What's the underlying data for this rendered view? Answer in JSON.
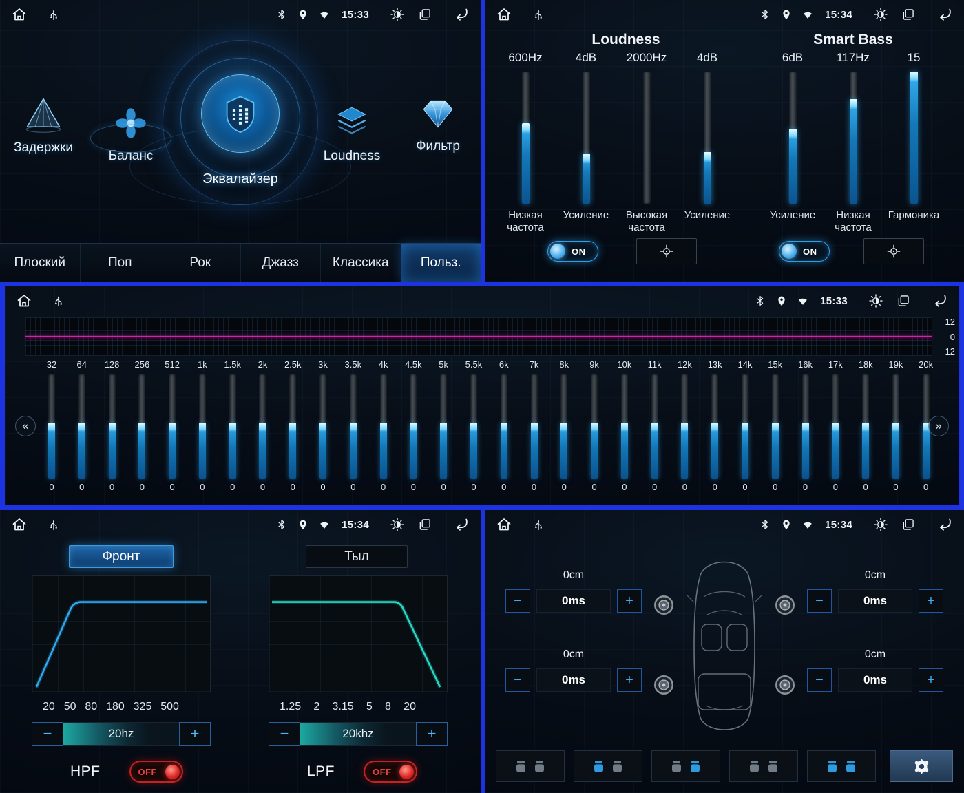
{
  "glyphs": {
    "minus": "−",
    "plus": "+",
    "chevrons_left": "«",
    "chevrons_right": "»"
  },
  "menu_panel": {
    "time": "15:33",
    "items": [
      {
        "label": "Задержки"
      },
      {
        "label": "Баланс"
      },
      {
        "label": "Эквалайзер"
      },
      {
        "label": "Loudness"
      },
      {
        "label": "Фильтр"
      }
    ],
    "presets": [
      {
        "label": "Плоский",
        "selected": false
      },
      {
        "label": "Поп",
        "selected": false
      },
      {
        "label": "Рок",
        "selected": false
      },
      {
        "label": "Джазз",
        "selected": false
      },
      {
        "label": "Классика",
        "selected": false
      },
      {
        "label": "Польз.",
        "selected": true
      }
    ]
  },
  "loudness_panel": {
    "time": "15:34",
    "section_titles": {
      "loudness": "Loudness",
      "smart_bass": "Smart Bass"
    },
    "sliders": [
      {
        "value": "600Hz",
        "label": "Низкая частота",
        "fill": 0.61
      },
      {
        "value": "4dB",
        "label": "Усиление",
        "fill": 0.38
      },
      {
        "value": "2000Hz",
        "label": "Высокая частота",
        "fill": 0
      },
      {
        "value": "4dB",
        "label": "Усиление",
        "fill": 0.39
      },
      {
        "value": "6dB",
        "label": "Усиление",
        "fill": 0.57
      },
      {
        "value": "117Hz",
        "label": "Низкая частота",
        "fill": 0.79
      },
      {
        "value": "15",
        "label": "Гармоника",
        "fill": 1
      }
    ],
    "loudness_toggle": "ON",
    "smart_bass_toggle": "ON"
  },
  "eq_panel": {
    "time": "15:33",
    "graph_scale": [
      "12",
      "0",
      "-12"
    ],
    "bands": [
      {
        "freq": "32",
        "value": "0"
      },
      {
        "freq": "64",
        "value": "0"
      },
      {
        "freq": "128",
        "value": "0"
      },
      {
        "freq": "256",
        "value": "0"
      },
      {
        "freq": "512",
        "value": "0"
      },
      {
        "freq": "1k",
        "value": "0"
      },
      {
        "freq": "1.5k",
        "value": "0"
      },
      {
        "freq": "2k",
        "value": "0"
      },
      {
        "freq": "2.5k",
        "value": "0"
      },
      {
        "freq": "3k",
        "value": "0"
      },
      {
        "freq": "3.5k",
        "value": "0"
      },
      {
        "freq": "4k",
        "value": "0"
      },
      {
        "freq": "4.5k",
        "value": "0"
      },
      {
        "freq": "5k",
        "value": "0"
      },
      {
        "freq": "5.5k",
        "value": "0"
      },
      {
        "freq": "6k",
        "value": "0"
      },
      {
        "freq": "7k",
        "value": "0"
      },
      {
        "freq": "8k",
        "value": "0"
      },
      {
        "freq": "9k",
        "value": "0"
      },
      {
        "freq": "10k",
        "value": "0"
      },
      {
        "freq": "11k",
        "value": "0"
      },
      {
        "freq": "12k",
        "value": "0"
      },
      {
        "freq": "13k",
        "value": "0"
      },
      {
        "freq": "14k",
        "value": "0"
      },
      {
        "freq": "15k",
        "value": "0"
      },
      {
        "freq": "16k",
        "value": "0"
      },
      {
        "freq": "17k",
        "value": "0"
      },
      {
        "freq": "18k",
        "value": "0"
      },
      {
        "freq": "19k",
        "value": "0"
      },
      {
        "freq": "20k",
        "value": "0"
      }
    ]
  },
  "filter_panel": {
    "time": "15:34",
    "tabs": [
      {
        "label": "Фронт",
        "selected": true
      },
      {
        "label": "Тыл",
        "selected": false
      }
    ],
    "hpf": {
      "name": "HPF",
      "scale": [
        "20",
        "50",
        "80",
        "180",
        "325",
        "500"
      ],
      "value": "20hz",
      "toggle": "OFF"
    },
    "lpf": {
      "name": "LPF",
      "scale": [
        "1.25",
        "2",
        "3.15",
        "5",
        "8",
        "20"
      ],
      "value": "20khz",
      "toggle": "OFF"
    }
  },
  "delay_panel": {
    "time": "15:34",
    "corners": [
      {
        "position": "front-left",
        "distance": "0cm",
        "delay": "0ms"
      },
      {
        "position": "front-right",
        "distance": "0cm",
        "delay": "0ms"
      },
      {
        "position": "rear-left",
        "distance": "0cm",
        "delay": "0ms"
      },
      {
        "position": "rear-right",
        "distance": "0cm",
        "delay": "0ms"
      }
    ]
  }
}
